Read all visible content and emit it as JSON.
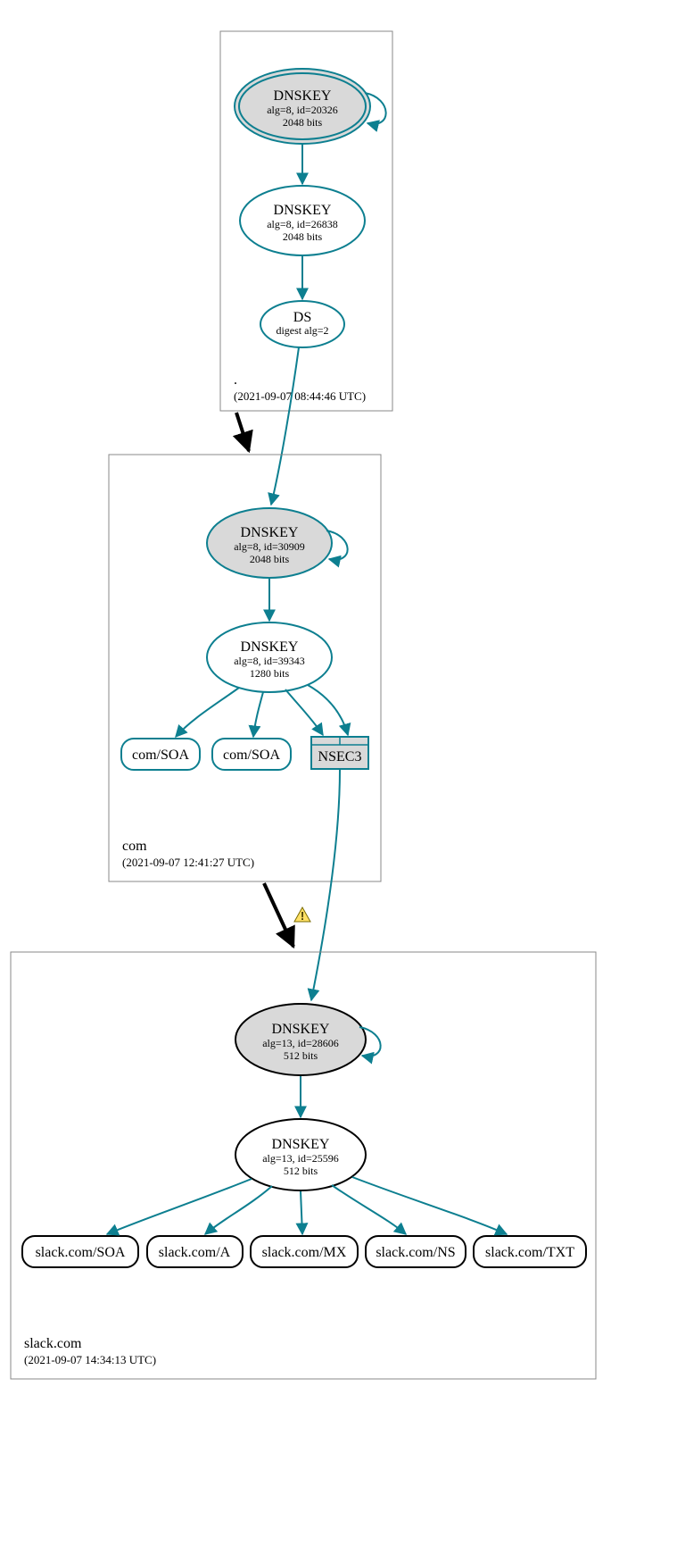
{
  "zones": {
    "root": {
      "name": ".",
      "timestamp": "(2021-09-07 08:44:46 UTC)",
      "nodes": {
        "ksk": {
          "title": "DNSKEY",
          "line2": "alg=8, id=20326",
          "line3": "2048 bits"
        },
        "zsk": {
          "title": "DNSKEY",
          "line2": "alg=8, id=26838",
          "line3": "2048 bits"
        },
        "ds": {
          "title": "DS",
          "line2": "digest alg=2"
        }
      }
    },
    "com": {
      "name": "com",
      "timestamp": "(2021-09-07 12:41:27 UTC)",
      "nodes": {
        "ksk": {
          "title": "DNSKEY",
          "line2": "alg=8, id=30909",
          "line3": "2048 bits"
        },
        "zsk": {
          "title": "DNSKEY",
          "line2": "alg=8, id=39343",
          "line3": "1280 bits"
        },
        "soa1": {
          "title": "com/SOA"
        },
        "soa2": {
          "title": "com/SOA"
        },
        "nsec3": {
          "title": "NSEC3"
        }
      }
    },
    "slack": {
      "name": "slack.com",
      "timestamp": "(2021-09-07 14:34:13 UTC)",
      "nodes": {
        "ksk": {
          "title": "DNSKEY",
          "line2": "alg=13, id=28606",
          "line3": "512 bits"
        },
        "zsk": {
          "title": "DNSKEY",
          "line2": "alg=13, id=25596",
          "line3": "512 bits"
        },
        "rr1": {
          "title": "slack.com/SOA"
        },
        "rr2": {
          "title": "slack.com/A"
        },
        "rr3": {
          "title": "slack.com/MX"
        },
        "rr4": {
          "title": "slack.com/NS"
        },
        "rr5": {
          "title": "slack.com/TXT"
        }
      }
    }
  },
  "warning_icon": "warning-icon"
}
